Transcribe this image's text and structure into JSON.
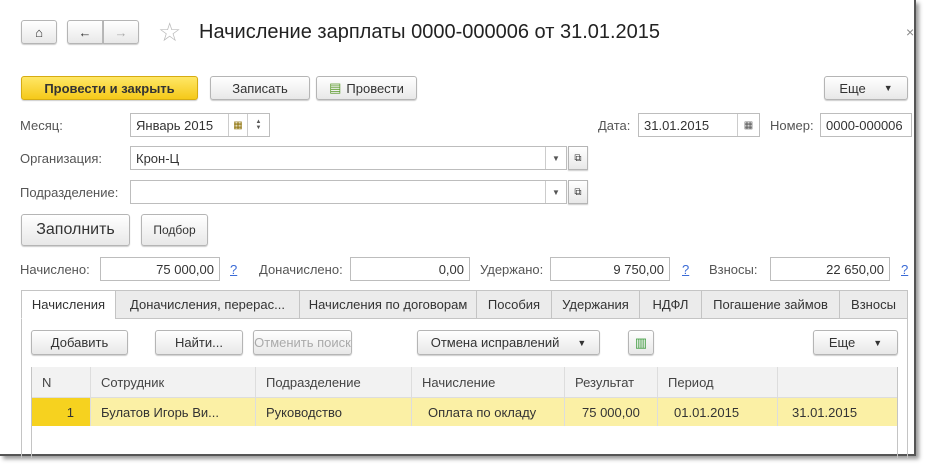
{
  "header": {
    "title": "Начисление зарплаты 0000-000006 от 31.01.2015",
    "close": "×"
  },
  "toolbar": {
    "post_close": "Провести и закрыть",
    "save": "Записать",
    "post": "Провести",
    "more": "Еще"
  },
  "form": {
    "month_label": "Месяц:",
    "month_value": "Январь 2015",
    "date_label": "Дата:",
    "date_value": "31.01.2015",
    "number_label": "Номер:",
    "number_value": "0000-000006",
    "org_label": "Организация:",
    "org_value": "Крон-Ц",
    "dept_label": "Подразделение:",
    "dept_value": "",
    "fill": "Заполнить",
    "select": "Подбор"
  },
  "totals": {
    "accrued_label": "Начислено:",
    "accrued": "75 000,00",
    "extra_label": "Доначислено:",
    "extra": "0,00",
    "withheld_label": "Удержано:",
    "withheld": "9 750,00",
    "contrib_label": "Взносы:",
    "contrib": "22 650,00",
    "help": "?"
  },
  "tabs": [
    "Начисления",
    "Доначисления, перерас...",
    "Начисления по договорам",
    "Пособия",
    "Удержания",
    "НДФЛ",
    "Погашение займов",
    "Взносы"
  ],
  "table_toolbar": {
    "add": "Добавить",
    "find": "Найти...",
    "cancel_search": "Отменить поиск",
    "corrections": "Отмена исправлений",
    "more": "Еще"
  },
  "table": {
    "columns": [
      "N",
      "Сотрудник",
      "Подразделение",
      "Начисление",
      "Результат",
      "Период",
      ""
    ],
    "rows": [
      [
        "1",
        "Булатов Игорь Ви...",
        "Руководство",
        "Оплата по окладу",
        "75 000,00",
        "01.01.2015",
        "31.01.2015"
      ]
    ]
  }
}
